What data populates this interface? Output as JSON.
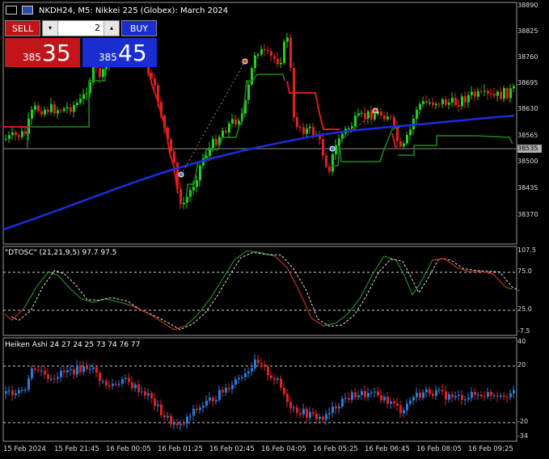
{
  "window": {
    "title": "NKDH24, M5:  Nikkei 225 (Globex): March 2024"
  },
  "trade_panel": {
    "sell_label": "SELL",
    "buy_label": "BUY",
    "volume": "2",
    "step_down_glyph": "▾",
    "step_up_glyph": "▴",
    "sell_price_prefix": "385",
    "sell_price_big": "35",
    "buy_price_prefix": "385",
    "buy_price_big": "45"
  },
  "price_axis": {
    "labels": [
      "38890",
      "38825",
      "38760",
      "38695",
      "38630",
      "38565",
      "38500",
      "38435",
      "38370"
    ],
    "current_price_tag": "38535"
  },
  "oscillator": {
    "label": "\"DTOSC\" (21,21,9,5) 97.7 97.5",
    "axis_labels": [
      "107.5",
      "75.0",
      "25.0",
      "-7.5"
    ]
  },
  "heiken": {
    "label": "Heiken Ashi 24 27 24 25 73 74 76 77",
    "axis_labels": [
      "40",
      "20",
      "-20",
      "-34"
    ]
  },
  "time_axis": {
    "labels": [
      "15 Feb 2024",
      "15 Feb 21:45",
      "16 Feb 00:05",
      "16 Feb 01:25",
      "16 Feb 02:45",
      "16 Feb 04:05",
      "16 Feb 05:25",
      "16 Feb 06:45",
      "16 Feb 08:05",
      "16 Feb 09:25"
    ]
  },
  "colors": {
    "bull": "#20d020",
    "bear": "#e02020",
    "ma": "#1a2ee0",
    "stop_green": "#1d8a1d",
    "stop_red": "#e01818",
    "osc_fast": "#2aa02a",
    "osc_dash": "#dddddd"
  },
  "icons": [
    "grid-icon",
    "chart-icon",
    "sell-arrow-icon",
    "buy-arrow-icon"
  ]
}
